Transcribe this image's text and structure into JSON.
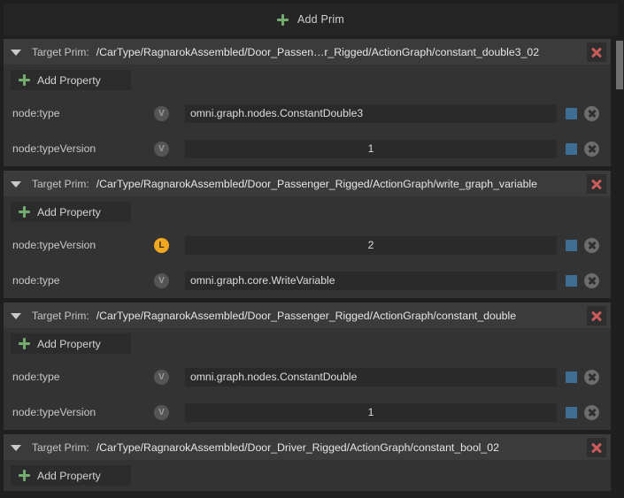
{
  "toolbar": {
    "add_prim_label": "Add Prim",
    "add_prim_icon": "plus-icon"
  },
  "colors": {
    "accent_green": "#73ab71",
    "delete_red": "#cc5b5b",
    "badge_orange": "#f0a823",
    "badge_gray": "#555555",
    "indicator_blue": "#3f6e94",
    "panel_bg": "#333333",
    "header_bg": "#3b3b3b",
    "field_bg": "#2a2a2a",
    "page_bg": "#1f1f1f"
  },
  "labels": {
    "target_prim": "Target Prim:",
    "add_property": "Add Property",
    "collapse_icon": "chevron-down-icon",
    "delete_icon": "close-x-icon",
    "clear_icon": "clear-circle-icon"
  },
  "sections": [
    {
      "target_prim_label": "Target Prim:",
      "path": "/CarType/RagnarokAssembled/Door_Passen…r_Rigged/ActionGraph/constant_double3_02",
      "add_property_label": "Add Property",
      "expanded": true,
      "properties": [
        {
          "name": "node:type",
          "badge": "V",
          "badge_kind": "v",
          "value": "omni.graph.nodes.ConstantDouble3",
          "align": "left"
        },
        {
          "name": "node:typeVersion",
          "badge": "V",
          "badge_kind": "v",
          "value": "1",
          "align": "center"
        }
      ]
    },
    {
      "target_prim_label": "Target Prim:",
      "path": "/CarType/RagnarokAssembled/Door_Passenger_Rigged/ActionGraph/write_graph_variable",
      "add_property_label": "Add Property",
      "expanded": true,
      "properties": [
        {
          "name": "node:typeVersion",
          "badge": "L",
          "badge_kind": "l",
          "value": "2",
          "align": "center"
        },
        {
          "name": "node:type",
          "badge": "V",
          "badge_kind": "v",
          "value": "omni.graph.core.WriteVariable",
          "align": "left"
        }
      ]
    },
    {
      "target_prim_label": "Target Prim:",
      "path": "/CarType/RagnarokAssembled/Door_Passenger_Rigged/ActionGraph/constant_double",
      "add_property_label": "Add Property",
      "expanded": true,
      "properties": [
        {
          "name": "node:type",
          "badge": "V",
          "badge_kind": "v",
          "value": "omni.graph.nodes.ConstantDouble",
          "align": "left"
        },
        {
          "name": "node:typeVersion",
          "badge": "V",
          "badge_kind": "v",
          "value": "1",
          "align": "center"
        }
      ]
    },
    {
      "target_prim_label": "Target Prim:",
      "path": "/CarType/RagnarokAssembled/Door_Driver_Rigged/ActionGraph/constant_bool_02",
      "add_property_label": "Add Property",
      "expanded": true,
      "properties": []
    }
  ]
}
